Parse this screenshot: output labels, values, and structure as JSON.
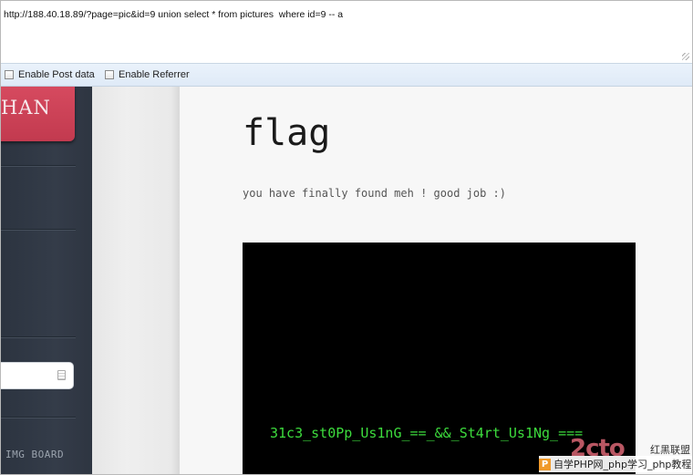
{
  "url_bar": {
    "text": "http://188.40.18.89/?page=pic&id=9 union select * from pictures  where id=9 -- a"
  },
  "options": {
    "post_label": "Enable Post data",
    "referrer_label": "Enable Referrer"
  },
  "sidebar": {
    "logo_text": "HAN",
    "nav_item": "IMG BOARD"
  },
  "main": {
    "title": "flag",
    "subtitle": "you have finally found meh ! good job :)",
    "picture_text": "31c3_st0Pp_Us1nG_==_&&_St4rt_Us1Ng_==="
  },
  "watermark": {
    "big": "2cto",
    "brand": "红黑联盟",
    "bar_text": "自学PHP网_php学习_php教程"
  },
  "colors": {
    "logo": "#c94257",
    "sidebar": "#323a46",
    "flag_green": "#3ddc3d"
  },
  "icons": {
    "search": "search-icon"
  }
}
